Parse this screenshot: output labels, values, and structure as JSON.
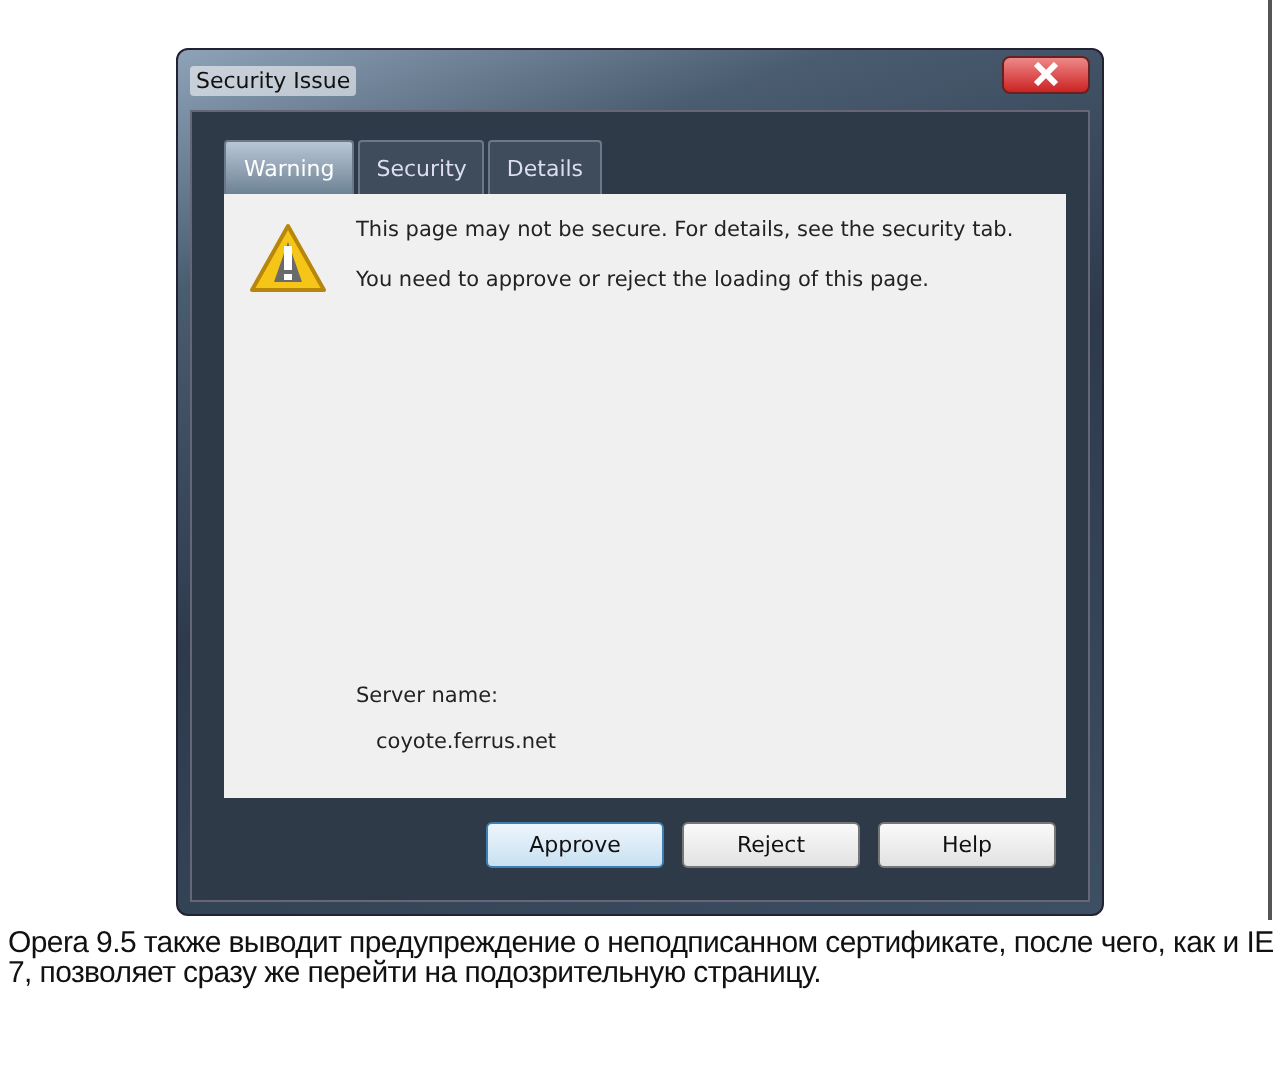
{
  "window": {
    "title": "Security Issue"
  },
  "tabs": [
    {
      "label": "Warning",
      "selected": true
    },
    {
      "label": "Security",
      "selected": false
    },
    {
      "label": "Details",
      "selected": false
    }
  ],
  "messages": [
    "This page may not be secure. For details, see the security tab.",
    "You need to approve or reject the loading of this page."
  ],
  "server": {
    "label": "Server name:",
    "value": "coyote.ferrus.net"
  },
  "buttons": [
    {
      "label": "Approve",
      "selected": true
    },
    {
      "label": "Reject",
      "selected": false
    },
    {
      "label": "Help",
      "selected": false
    }
  ],
  "caption": "Opera 9.5 также выводит предупреждение о неподписанном сертификате, после чего, как и IE 7, позволяет сразу же перейти на подозрительную страницу."
}
